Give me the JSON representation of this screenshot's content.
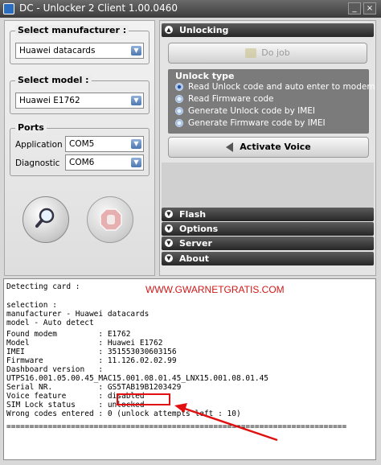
{
  "window": {
    "title": "DC - Unlocker 2 Client 1.00.0460",
    "minimize": "_",
    "close": "×"
  },
  "left": {
    "manufacturer": {
      "label": "Select manufacturer :",
      "value": "Huawei datacards"
    },
    "model": {
      "label": "Select model :",
      "value": "Huawei E1762"
    },
    "ports": {
      "label": "Ports",
      "application_label": "Application",
      "application_value": "COM5",
      "diagnostic_label": "Diagnostic",
      "diagnostic_value": "COM6"
    },
    "search_icon": "magnifier-icon",
    "stop_icon": "stop-hand-icon"
  },
  "right": {
    "unlocking_header": "Unlocking",
    "do_job": "Do job",
    "unlock_type": {
      "title": "Unlock type",
      "options": [
        "Read Unlock code and auto enter to modem",
        "Read Firmware code",
        "Generate Unlock code by IMEI",
        "Generate Firmware code by IMEI"
      ],
      "selected": 0
    },
    "activate_voice": "Activate Voice",
    "sections": [
      "Flash",
      "Options",
      "Server",
      "About"
    ]
  },
  "log": {
    "watermark": "WWW.GWARNETGRATIS.COM",
    "lines": [
      "Detecting card :",
      "",
      "selection :",
      "manufacturer - Huawei datacards",
      "model - Auto detect",
      "",
      "Found modem         : E1762",
      "Model               : Huawei E1762",
      "IMEI                : 351553030603156",
      "Firmware            : 11.126.02.02.99",
      "Dashboard version   :",
      "UTPS16.001.05.00.45_MAC15.001.08.01.45_LNX15.001.08.01.45",
      "Serial NR.          : GS5TAB19B1203429",
      "Voice feature       : disabled",
      "SIM Lock status     : unlocked",
      "Wrong codes entered : 0 (unlock attempts left : 10)",
      "",
      "=========================================================================="
    ]
  },
  "colors": {
    "header_dark": "#262626",
    "highlight_red": "#e01010",
    "radio_blue": "#6f9bd0"
  }
}
